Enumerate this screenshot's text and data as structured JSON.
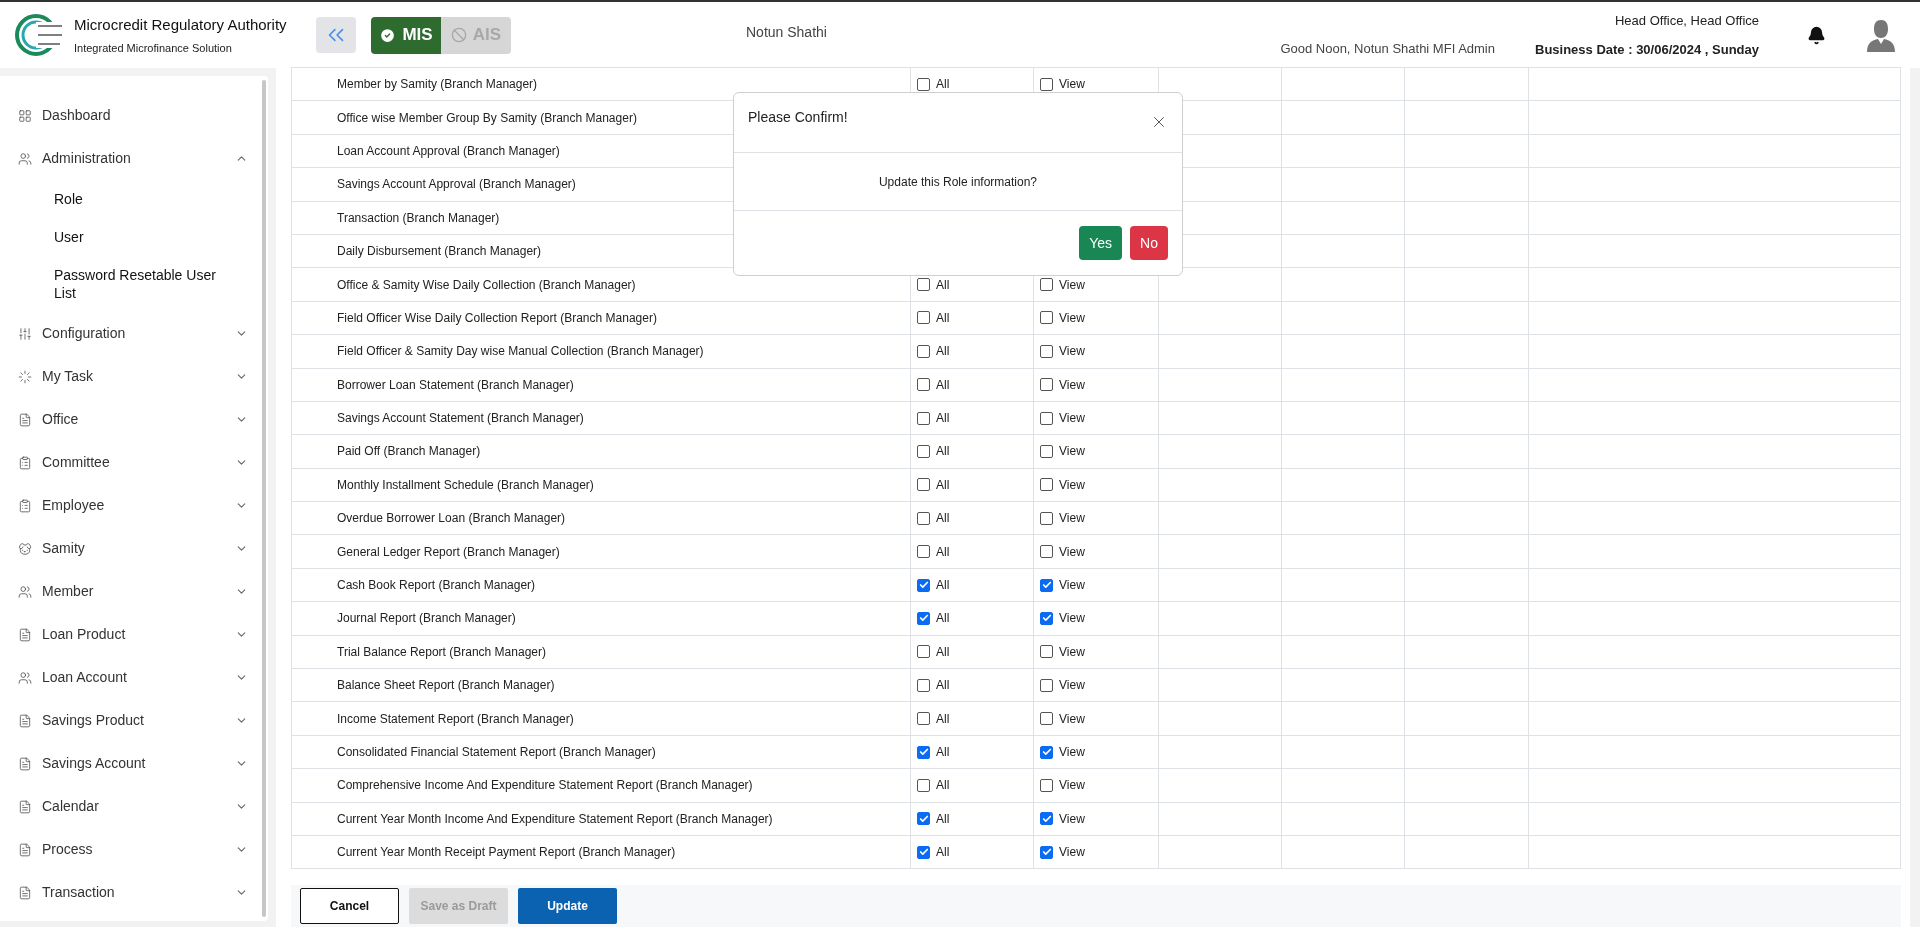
{
  "header": {
    "org_title": "Microcredit Regulatory Authority",
    "org_subtitle": "Integrated Microfinance Solution",
    "modules": [
      {
        "label": "MIS",
        "selected": true
      },
      {
        "label": "AIS",
        "selected": false
      }
    ],
    "center_title": "Notun Shathi",
    "greeting": "Good Noon, Notun Shathi MFI Admin",
    "office": "Head Office, Head Office",
    "business_date": "Business Date : 30/06/2024 , Sunday"
  },
  "sidebar": {
    "items": [
      {
        "label": "Dashboard",
        "kind": "link"
      },
      {
        "label": "Administration",
        "kind": "group",
        "expanded": true,
        "children": [
          {
            "label": "Role"
          },
          {
            "label": "User"
          },
          {
            "label": "Password Resetable User List"
          }
        ]
      },
      {
        "label": "Configuration",
        "kind": "group",
        "expanded": false
      },
      {
        "label": "My Task",
        "kind": "group",
        "expanded": false
      },
      {
        "label": "Office",
        "kind": "group",
        "expanded": false
      },
      {
        "label": "Committee",
        "kind": "group",
        "expanded": false
      },
      {
        "label": "Employee",
        "kind": "group",
        "expanded": false
      },
      {
        "label": "Samity",
        "kind": "group",
        "expanded": false
      },
      {
        "label": "Member",
        "kind": "group",
        "expanded": false
      },
      {
        "label": "Loan Product",
        "kind": "group",
        "expanded": false
      },
      {
        "label": "Loan Account",
        "kind": "group",
        "expanded": false
      },
      {
        "label": "Savings Product",
        "kind": "group",
        "expanded": false
      },
      {
        "label": "Savings Account",
        "kind": "group",
        "expanded": false
      },
      {
        "label": "Calendar",
        "kind": "group",
        "expanded": false
      },
      {
        "label": "Process",
        "kind": "group",
        "expanded": false
      },
      {
        "label": "Transaction",
        "kind": "group",
        "expanded": false
      }
    ]
  },
  "table": {
    "rows": [
      {
        "name": "Member by Samity (Branch Manager)",
        "permissions": [
          {
            "label": "All",
            "checked": false
          },
          {
            "label": "View",
            "checked": false
          }
        ]
      },
      {
        "name": "Office wise Member Group By Samity (Branch Manager)"
      },
      {
        "name": "Loan Account Approval (Branch Manager)"
      },
      {
        "name": "Savings Account Approval (Branch Manager)"
      },
      {
        "name": "Transaction (Branch Manager)"
      },
      {
        "name": "Daily Disbursement (Branch Manager)"
      },
      {
        "name": "Office & Samity Wise Daily Collection (Branch Manager)",
        "permissions": [
          {
            "label": "All",
            "checked": false
          },
          {
            "label": "View",
            "checked": false
          }
        ]
      },
      {
        "name": "Field Officer Wise Daily Collection Report (Branch Manager)",
        "permissions": [
          {
            "label": "All",
            "checked": false
          },
          {
            "label": "View",
            "checked": false
          }
        ]
      },
      {
        "name": "Field Officer & Samity Day wise Manual Collection (Branch Manager)",
        "permissions": [
          {
            "label": "All",
            "checked": false
          },
          {
            "label": "View",
            "checked": false
          }
        ]
      },
      {
        "name": "Borrower Loan Statement (Branch Manager)",
        "permissions": [
          {
            "label": "All",
            "checked": false
          },
          {
            "label": "View",
            "checked": false
          }
        ]
      },
      {
        "name": "Savings Account Statement (Branch Manager)",
        "permissions": [
          {
            "label": "All",
            "checked": false
          },
          {
            "label": "View",
            "checked": false
          }
        ]
      },
      {
        "name": "Paid Off (Branch Manager)",
        "permissions": [
          {
            "label": "All",
            "checked": false
          },
          {
            "label": "View",
            "checked": false
          }
        ]
      },
      {
        "name": "Monthly Installment Schedule (Branch Manager)",
        "permissions": [
          {
            "label": "All",
            "checked": false
          },
          {
            "label": "View",
            "checked": false
          }
        ]
      },
      {
        "name": "Overdue Borrower Loan (Branch Manager)",
        "permissions": [
          {
            "label": "All",
            "checked": false
          },
          {
            "label": "View",
            "checked": false
          }
        ]
      },
      {
        "name": "General Ledger Report (Branch Manager)",
        "permissions": [
          {
            "label": "All",
            "checked": false
          },
          {
            "label": "View",
            "checked": false
          }
        ]
      },
      {
        "name": "Cash Book Report (Branch Manager)",
        "permissions": [
          {
            "label": "All",
            "checked": true
          },
          {
            "label": "View",
            "checked": true
          }
        ]
      },
      {
        "name": "Journal Report (Branch Manager)",
        "permissions": [
          {
            "label": "All",
            "checked": true
          },
          {
            "label": "View",
            "checked": true
          }
        ]
      },
      {
        "name": "Trial Balance Report (Branch Manager)",
        "permissions": [
          {
            "label": "All",
            "checked": false
          },
          {
            "label": "View",
            "checked": false
          }
        ]
      },
      {
        "name": "Balance Sheet Report (Branch Manager)",
        "permissions": [
          {
            "label": "All",
            "checked": false
          },
          {
            "label": "View",
            "checked": false
          }
        ]
      },
      {
        "name": "Income Statement Report (Branch Manager)",
        "permissions": [
          {
            "label": "All",
            "checked": false
          },
          {
            "label": "View",
            "checked": false
          }
        ]
      },
      {
        "name": "Consolidated Financial Statement Report (Branch Manager)",
        "permissions": [
          {
            "label": "All",
            "checked": true
          },
          {
            "label": "View",
            "checked": true
          }
        ]
      },
      {
        "name": "Comprehensive Income And Expenditure Statement Report (Branch Manager)",
        "permissions": [
          {
            "label": "All",
            "checked": false
          },
          {
            "label": "View",
            "checked": false
          }
        ]
      },
      {
        "name": "Current Year Month Income And Expenditure Statement Report (Branch Manager)",
        "permissions": [
          {
            "label": "All",
            "checked": true
          },
          {
            "label": "View",
            "checked": true
          }
        ]
      },
      {
        "name": "Current Year Month Receipt Payment Report (Branch Manager)",
        "permissions": [
          {
            "label": "All",
            "checked": true
          },
          {
            "label": "View",
            "checked": true
          }
        ]
      }
    ]
  },
  "actions": [
    {
      "label": "Cancel",
      "kind": "outline",
      "disabled": false
    },
    {
      "label": "Save as Draft",
      "disabled": true
    },
    {
      "label": "Update",
      "kind": "primary",
      "disabled": false
    }
  ],
  "dialog": {
    "title": "Please Confirm!",
    "message": "Update this Role information?",
    "buttons": [
      {
        "label": "Yes",
        "kind": "confirm"
      },
      {
        "label": "No",
        "kind": "cancel"
      }
    ]
  }
}
